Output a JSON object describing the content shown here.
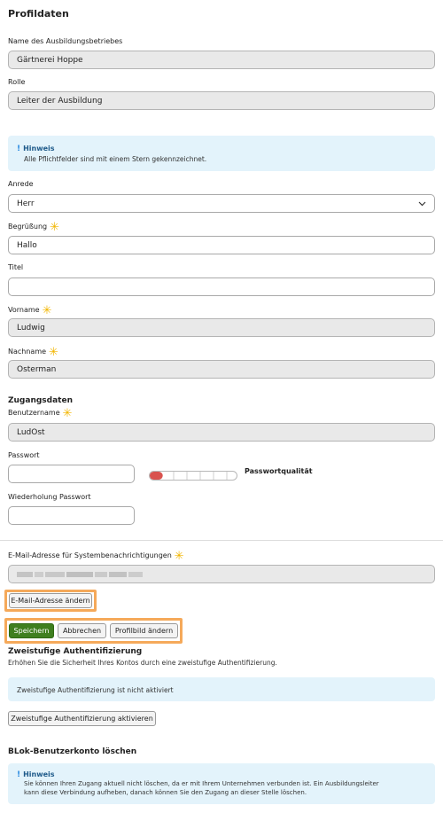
{
  "profile": {
    "heading": "Profildaten",
    "company_label": "Name des Ausbildungsbetriebes",
    "company_value": "Gärtnerei Hoppe",
    "role_label": "Rolle",
    "role_value": "Leiter der Ausbildung"
  },
  "hint1": {
    "title": "Hinweis",
    "text": "Alle Pflichtfelder sind mit einem Stern gekennzeichnet."
  },
  "form": {
    "salutation_label": "Anrede",
    "salutation_value": "Herr",
    "greeting_label": "Begrüßung",
    "greeting_value": "Hallo",
    "title_label": "Titel",
    "title_value": "",
    "firstname_label": "Vorname",
    "firstname_value": "Ludwig",
    "lastname_label": "Nachname",
    "lastname_value": "Osterman"
  },
  "access": {
    "heading": "Zugangsdaten",
    "username_label": "Benutzername",
    "username_value": "LudOst",
    "password_label": "Passwort",
    "password_quality_label": "Passwortqualität",
    "password_strength": 0.15,
    "repeat_label": "Wiederholung Passwort"
  },
  "email": {
    "label": "E-Mail-Adresse für Systembenachrichtigungen",
    "change_button": "E-Mail-Adresse ändern"
  },
  "actions": {
    "save": "Speichern",
    "cancel": "Abbrechen",
    "change_picture": "Profilbild ändern"
  },
  "twofactor": {
    "heading": "Zweistufige Authentifizierung",
    "description": "Erhöhen Sie die Sicherheit Ihres Kontos durch eine zweistufige Authentifizierung.",
    "status": "Zweistufige Authentifizierung ist nicht aktiviert",
    "activate_button": "Zweistufige Authentifizierung aktivieren"
  },
  "delete": {
    "heading": "BLok-Benutzerkonto löschen",
    "hint_title": "Hinweis",
    "hint_line1": "Sie können Ihren Zugang aktuell nicht löschen, da er mit Ihrem Unternehmen verbunden ist. Ein Ausbildungsleiter",
    "hint_line2": "kann diese Verbindung aufheben, danach können Sie den Zugang an dieser Stelle löschen."
  },
  "colors": {
    "primary_button": "#3f7f1f",
    "info_background": "#e3f3fb",
    "required_star": "#f2b600",
    "highlight_frame": "#f5a95a",
    "strength_low": "#d9534f"
  },
  "icons": {
    "required": "star-icon",
    "hint": "exclamation-icon",
    "select_arrow": "chevron-down-icon"
  }
}
